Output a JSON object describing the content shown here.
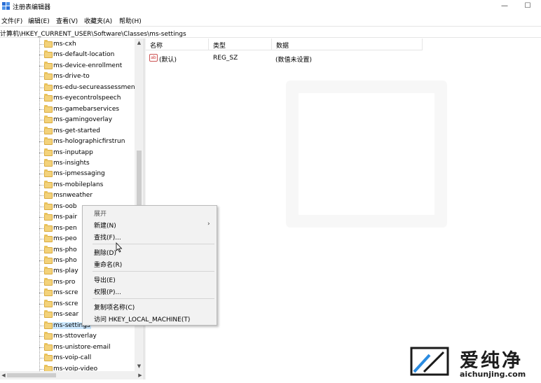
{
  "window": {
    "title": "注册表编辑器",
    "minimize": "—",
    "maximize": "☐",
    "app_icon": "regedit-icon"
  },
  "menubar": {
    "items": [
      "文件(F)",
      "编辑(E)",
      "查看(V)",
      "收藏夹(A)",
      "帮助(H)"
    ]
  },
  "address": {
    "path": "计算机\\HKEY_CURRENT_USER\\Software\\Classes\\ms-settings"
  },
  "tree": {
    "items": [
      "ms-cxh",
      "ms-default-location",
      "ms-device-enrollment",
      "ms-drive-to",
      "ms-edu-secureassessment",
      "ms-eyecontrolspeech",
      "ms-gamebarservices",
      "ms-gamingoverlay",
      "ms-get-started",
      "ms-holographicfirstrun",
      "ms-inputapp",
      "ms-insights",
      "ms-ipmessaging",
      "ms-mobileplans",
      "msnweather",
      "ms-oob",
      "ms-pair",
      "ms-pen",
      "ms-peo",
      "ms-pho",
      "ms-pho",
      "ms-play",
      "ms-pro",
      "ms-scre",
      "ms-scre",
      "ms-sear",
      "ms-settings",
      "ms-sttoverlay",
      "ms-unistore-email",
      "ms-voip-call",
      "ms-voip-video"
    ],
    "selected": "ms-settings"
  },
  "values_pane": {
    "columns": [
      "名称",
      "类型",
      "数据"
    ],
    "rows": [
      {
        "name": "(默认)",
        "type": "REG_SZ",
        "data": "(数值未设置)",
        "icon": "string-value-icon"
      }
    ]
  },
  "context_menu": {
    "items": {
      "expand": "展开",
      "new": "新建(N)",
      "find": "查找(F)...",
      "delete": "删除(D)",
      "rename": "重命名(R)",
      "export": "导出(E)",
      "permissions": "权限(P)...",
      "copy_key_name": "复制项名称(C)",
      "visit": "访问 HKEY_LOCAL_MACHINE(T)"
    },
    "submenu_arrow": "›"
  },
  "watermark": {
    "brand": "爱纯净",
    "url": "aichunjing.com"
  }
}
